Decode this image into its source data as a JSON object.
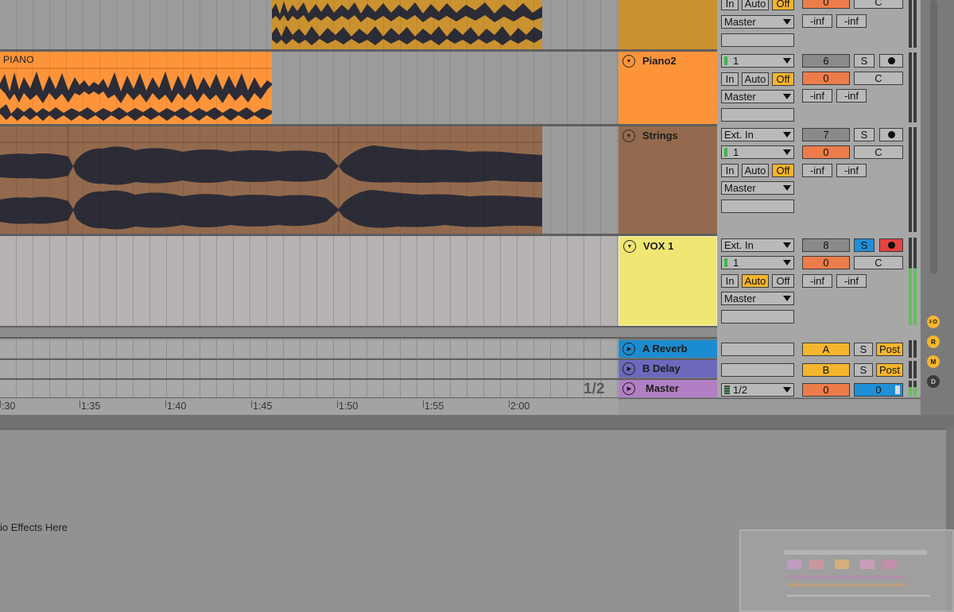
{
  "tracks": [
    {
      "name": "",
      "color": "#cb9230",
      "input_type": "",
      "input_channel": "",
      "monitor": [
        "In",
        "Auto",
        "Off"
      ],
      "monitor_active": "Off",
      "output": "Master",
      "track_number": "",
      "volume": "0",
      "pan": "C",
      "sends": [
        "-inf",
        "-inf"
      ]
    },
    {
      "name": "Piano2",
      "color": "#fe943a",
      "input_type": "",
      "input_channel": "1",
      "monitor": [
        "In",
        "Auto",
        "Off"
      ],
      "monitor_active": "Off",
      "output": "Master",
      "track_number": "6",
      "solo": "S",
      "volume": "0",
      "pan": "C",
      "sends": [
        "-inf",
        "-inf"
      ]
    },
    {
      "name": "Strings",
      "color": "#936a4d",
      "input_type": "Ext. In",
      "input_channel": "1",
      "monitor": [
        "In",
        "Auto",
        "Off"
      ],
      "monitor_active": "Off",
      "output": "Master",
      "track_number": "7",
      "solo": "S",
      "volume": "0",
      "pan": "C",
      "sends": [
        "-inf",
        "-inf"
      ]
    },
    {
      "name": "VOX 1",
      "color": "#efe673",
      "input_type": "Ext. In",
      "input_channel": "1",
      "monitor": [
        "In",
        "Auto",
        "Off"
      ],
      "monitor_active": "Auto",
      "output": "Master",
      "track_number": "8",
      "solo": "S",
      "volume": "0",
      "pan": "C",
      "sends": [
        "-inf",
        "-inf"
      ]
    }
  ],
  "clips": {
    "piano_label": "PIANO"
  },
  "returns": [
    {
      "name": "A Reverb",
      "color": "#1b8cd0",
      "letter": "A",
      "solo": "S",
      "post": "Post"
    },
    {
      "name": "B Delay",
      "color": "#6c69bd",
      "letter": "B",
      "solo": "S",
      "post": "Post"
    }
  ],
  "master": {
    "name": "Master",
    "color": "#b27ec4",
    "cue": "1/2",
    "volume": "0",
    "pan_value": "0"
  },
  "page_indicator": "1/2",
  "ruler_ticks": [
    ":30",
    "1:35",
    "1:40",
    "1:45",
    "1:50",
    "1:55",
    "2:00"
  ],
  "side_buttons": [
    "I·O",
    "R",
    "M",
    "D"
  ],
  "device_drop_text": "io Effects Here"
}
